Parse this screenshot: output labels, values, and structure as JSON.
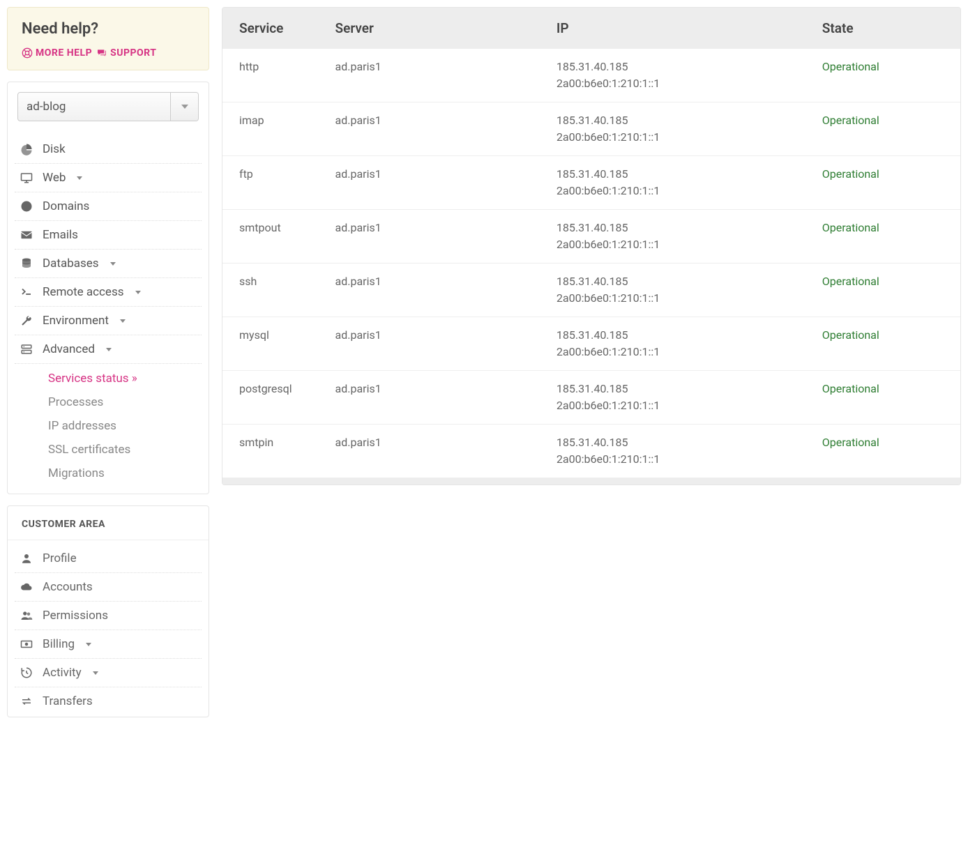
{
  "help": {
    "title": "Need help?",
    "more_label": "MORE HELP",
    "support_label": "SUPPORT"
  },
  "account_selector": {
    "value": "ad-blog"
  },
  "nav": {
    "items": [
      {
        "label": "Disk",
        "icon": "pie-chart-icon",
        "has_caret": false
      },
      {
        "label": "Web",
        "icon": "monitor-icon",
        "has_caret": true
      },
      {
        "label": "Domains",
        "icon": "globe-icon",
        "has_caret": false
      },
      {
        "label": "Emails",
        "icon": "envelope-icon",
        "has_caret": false
      },
      {
        "label": "Databases",
        "icon": "database-icon",
        "has_caret": true
      },
      {
        "label": "Remote access",
        "icon": "terminal-icon",
        "has_caret": true
      },
      {
        "label": "Environment",
        "icon": "wrench-icon",
        "has_caret": true
      },
      {
        "label": "Advanced",
        "icon": "server-icon",
        "has_caret": true
      }
    ],
    "advanced_sub": [
      {
        "label": "Services status »",
        "active": true
      },
      {
        "label": "Processes",
        "active": false
      },
      {
        "label": "IP addresses",
        "active": false
      },
      {
        "label": "SSL certificates",
        "active": false
      },
      {
        "label": "Migrations",
        "active": false
      }
    ]
  },
  "customer": {
    "heading": "CUSTOMER AREA",
    "items": [
      {
        "label": "Profile",
        "icon": "user-icon",
        "has_caret": false
      },
      {
        "label": "Accounts",
        "icon": "cloud-icon",
        "has_caret": false
      },
      {
        "label": "Permissions",
        "icon": "users-icon",
        "has_caret": false
      },
      {
        "label": "Billing",
        "icon": "money-icon",
        "has_caret": true
      },
      {
        "label": "Activity",
        "icon": "history-icon",
        "has_caret": true
      },
      {
        "label": "Transfers",
        "icon": "exchange-icon",
        "has_caret": false
      }
    ]
  },
  "table": {
    "headers": [
      "Service",
      "Server",
      "IP",
      "State"
    ],
    "rows": [
      {
        "service": "http",
        "server": "ad.paris1",
        "ip4": "185.31.40.185",
        "ip6": "2a00:b6e0:1:210:1::1",
        "state": "Operational"
      },
      {
        "service": "imap",
        "server": "ad.paris1",
        "ip4": "185.31.40.185",
        "ip6": "2a00:b6e0:1:210:1::1",
        "state": "Operational"
      },
      {
        "service": "ftp",
        "server": "ad.paris1",
        "ip4": "185.31.40.185",
        "ip6": "2a00:b6e0:1:210:1::1",
        "state": "Operational"
      },
      {
        "service": "smtpout",
        "server": "ad.paris1",
        "ip4": "185.31.40.185",
        "ip6": "2a00:b6e0:1:210:1::1",
        "state": "Operational"
      },
      {
        "service": "ssh",
        "server": "ad.paris1",
        "ip4": "185.31.40.185",
        "ip6": "2a00:b6e0:1:210:1::1",
        "state": "Operational"
      },
      {
        "service": "mysql",
        "server": "ad.paris1",
        "ip4": "185.31.40.185",
        "ip6": "2a00:b6e0:1:210:1::1",
        "state": "Operational"
      },
      {
        "service": "postgresql",
        "server": "ad.paris1",
        "ip4": "185.31.40.185",
        "ip6": "2a00:b6e0:1:210:1::1",
        "state": "Operational"
      },
      {
        "service": "smtpin",
        "server": "ad.paris1",
        "ip4": "185.31.40.185",
        "ip6": "2a00:b6e0:1:210:1::1",
        "state": "Operational"
      }
    ]
  },
  "colors": {
    "accent": "#d63384",
    "state_ok": "#2e7d32"
  }
}
